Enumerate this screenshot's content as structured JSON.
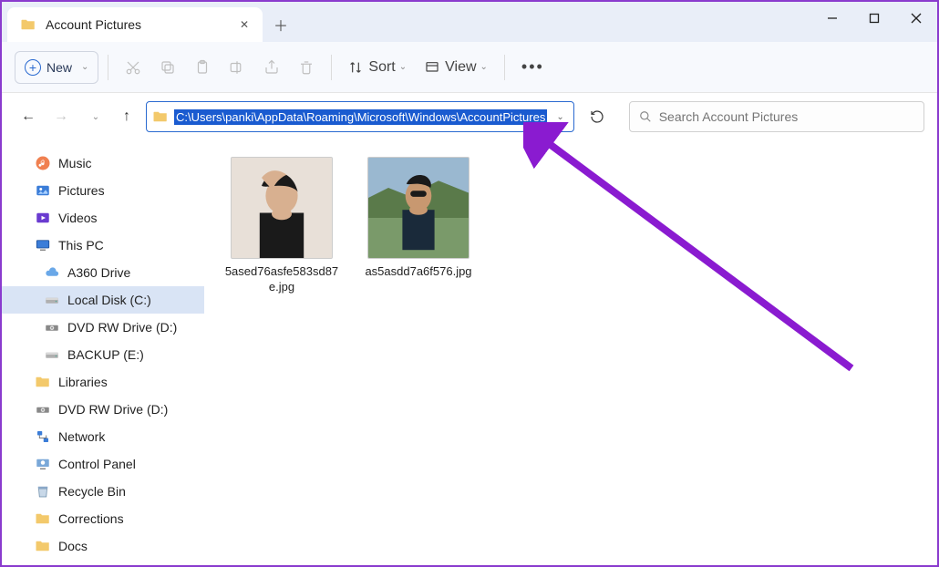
{
  "tab": {
    "title": "Account Pictures"
  },
  "toolbar": {
    "new": "New",
    "sort": "Sort",
    "view": "View"
  },
  "address": {
    "path": "C:\\Users\\panki\\AppData\\Roaming\\Microsoft\\Windows\\AccountPictures"
  },
  "search": {
    "placeholder": "Search Account Pictures"
  },
  "sidebar": [
    {
      "label": "Music",
      "icon": "music",
      "indent": "root"
    },
    {
      "label": "Pictures",
      "icon": "pictures",
      "indent": "root"
    },
    {
      "label": "Videos",
      "icon": "videos",
      "indent": "root"
    },
    {
      "label": "This PC",
      "icon": "thispc",
      "indent": "root"
    },
    {
      "label": "A360 Drive",
      "icon": "cloud",
      "indent": "child"
    },
    {
      "label": "Local Disk (C:)",
      "icon": "disk",
      "indent": "child",
      "selected": true
    },
    {
      "label": "DVD RW Drive (D:)",
      "icon": "dvd",
      "indent": "child"
    },
    {
      "label": "BACKUP (E:)",
      "icon": "disk",
      "indent": "child"
    },
    {
      "label": "Libraries",
      "icon": "folder",
      "indent": "root"
    },
    {
      "label": "DVD RW Drive (D:)",
      "icon": "dvd",
      "indent": "root"
    },
    {
      "label": "Network",
      "icon": "network",
      "indent": "root"
    },
    {
      "label": "Control Panel",
      "icon": "cpanel",
      "indent": "root"
    },
    {
      "label": "Recycle Bin",
      "icon": "recycle",
      "indent": "root"
    },
    {
      "label": "Corrections",
      "icon": "folder",
      "indent": "root"
    },
    {
      "label": "Docs",
      "icon": "folder",
      "indent": "root"
    }
  ],
  "files": [
    {
      "name": "5ased76asfe583sd87e.jpg",
      "thumb": "person1"
    },
    {
      "name": "as5asdd7a6f576.jpg",
      "thumb": "person2"
    }
  ],
  "annotation": {
    "arrow_color": "#8a1bd0"
  }
}
